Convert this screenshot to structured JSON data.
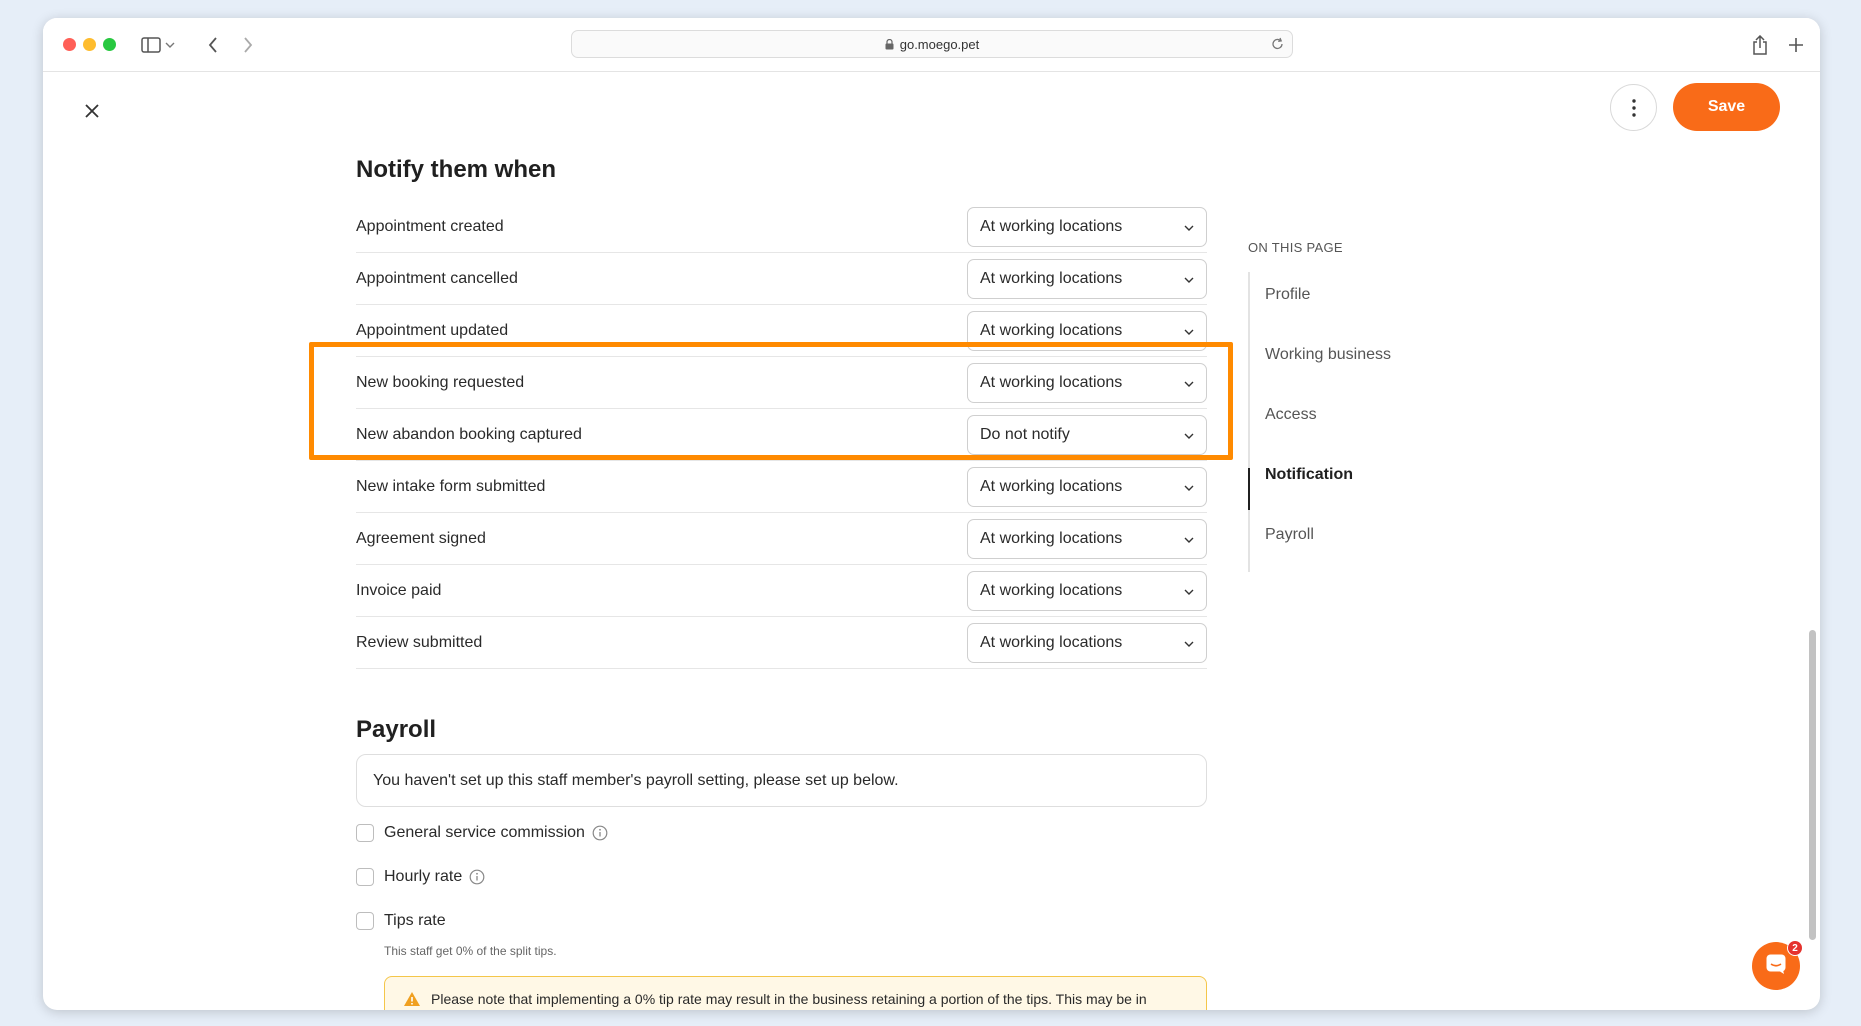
{
  "browser": {
    "url": "go.moego.pet"
  },
  "header": {
    "save_label": "Save"
  },
  "notify": {
    "title": "Notify them when",
    "rows": [
      {
        "label": "Appointment created",
        "value": "At working locations"
      },
      {
        "label": "Appointment cancelled",
        "value": "At working locations"
      },
      {
        "label": "Appointment updated",
        "value": "At working locations"
      },
      {
        "label": "New booking requested",
        "value": "At working locations"
      },
      {
        "label": "New abandon booking captured",
        "value": "Do not notify"
      },
      {
        "label": "New intake form submitted",
        "value": "At working locations"
      },
      {
        "label": "Agreement signed",
        "value": "At working locations"
      },
      {
        "label": "Invoice paid",
        "value": "At working locations"
      },
      {
        "label": "Review submitted",
        "value": "At working locations"
      }
    ]
  },
  "toc": {
    "heading": "ON THIS PAGE",
    "items": [
      {
        "label": "Profile"
      },
      {
        "label": "Working business"
      },
      {
        "label": "Access"
      },
      {
        "label": "Notification"
      },
      {
        "label": "Payroll"
      }
    ],
    "active": "Notification"
  },
  "payroll": {
    "title": "Payroll",
    "notice": "You haven't set up this staff member's payroll setting, please set up below.",
    "options": [
      {
        "label": "General service commission"
      },
      {
        "label": "Hourly rate"
      },
      {
        "label": "Tips rate"
      }
    ],
    "tips_sub": "This staff get 0% of the split tips.",
    "warning": "Please note that implementing a 0% tip rate may result in the business retaining a portion of the tips. This may be in"
  },
  "chat": {
    "badge": "2"
  },
  "colors": {
    "accent": "#f96b18",
    "highlight": "#ff8a00"
  }
}
